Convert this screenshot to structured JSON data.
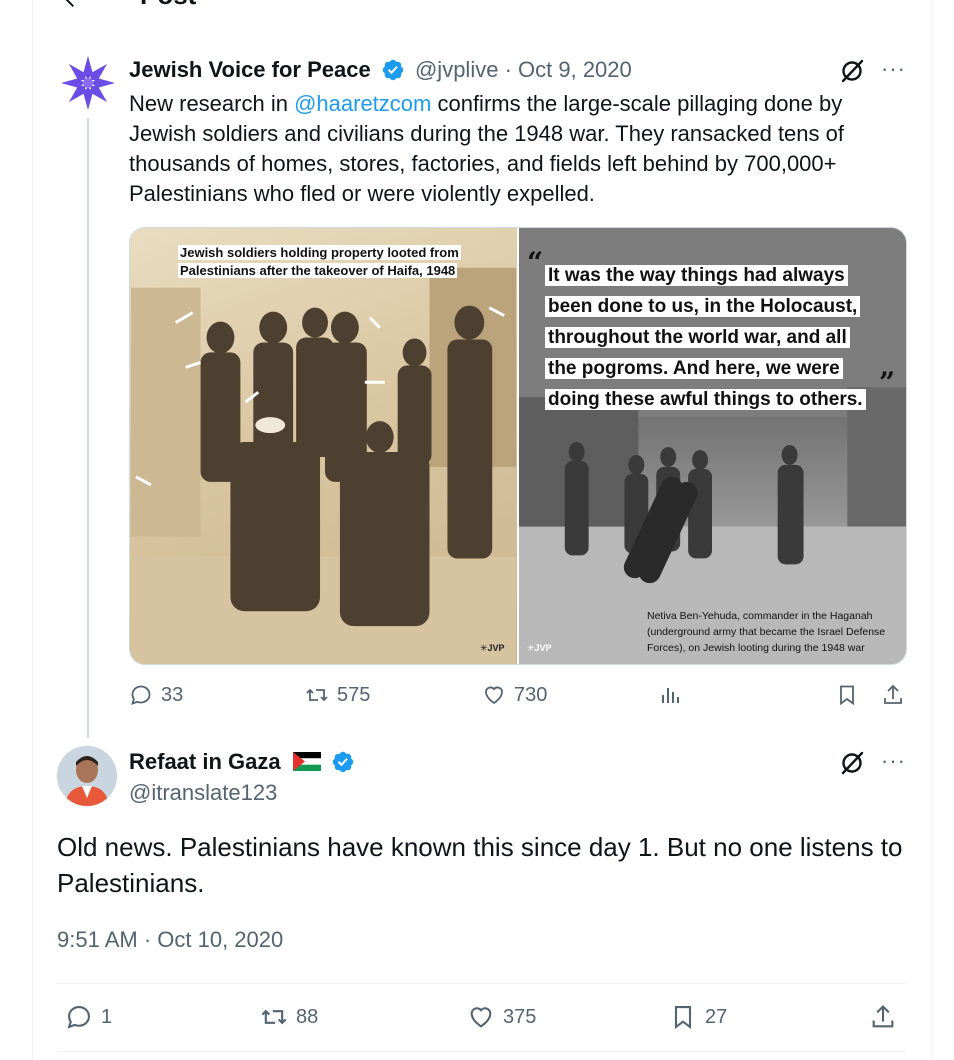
{
  "header": {
    "title": "Post"
  },
  "parent": {
    "name": "Jewish Voice for Peace",
    "handle": "@jvplive",
    "date": "Oct 9, 2020",
    "text_before": "New research in ",
    "mention": "@haaretzcom",
    "text_after": " confirms the large-scale pillaging done by Jewish soldiers and civilians during the 1948 war. They ransacked tens of thousands of homes, stores, factories, and fields left behind by 700,000+ Palestinians who fled or were violently expelled.",
    "media": {
      "left_caption_1": "Jewish soldiers holding property looted from",
      "left_caption_2": "Palestinians after the takeover of Haifa, 1948",
      "quote_lines": [
        "It was the way things had always",
        "been done to us, in the Holocaust,",
        "throughout the world war, and all",
        "the pogroms. And here, we were",
        "doing these awful things to others."
      ],
      "right_caption_1": "Netiva Ben-Yehuda, commander in the Haganah",
      "right_caption_2": "(underground army that became the Israel Defense",
      "right_caption_3": "Forces), on Jewish looting during the 1948 war",
      "logo_text": "JVP"
    },
    "stats": {
      "replies": "33",
      "reposts": "575",
      "likes": "730"
    }
  },
  "reply": {
    "name": "Refaat in Gaza",
    "handle": "@itranslate123",
    "text": "Old news. Palestinians have known this since day 1. But no one listens to Palestinians.",
    "timestamp": "9:51 AM · Oct 10, 2020",
    "stats": {
      "replies": "1",
      "reposts": "88",
      "likes": "375",
      "bookmarks": "27"
    }
  },
  "colors": {
    "accent": "#1d9bf0",
    "muted": "#536471",
    "jvp_star": "#6b4de6"
  }
}
